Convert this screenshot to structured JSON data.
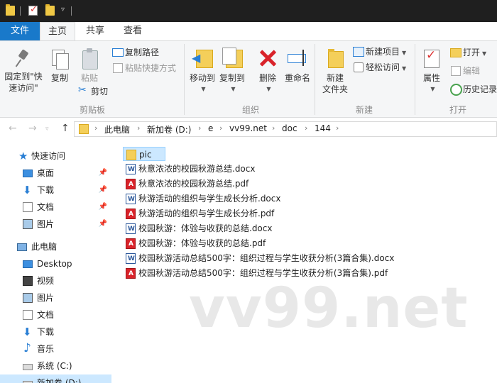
{
  "titlebar": {
    "icons": [
      "folder-icon",
      "properties-icon",
      "new-folder-icon"
    ]
  },
  "tabs": {
    "file": "文件",
    "home": "主页",
    "share": "共享",
    "view": "查看"
  },
  "ribbon": {
    "clipboard": {
      "label": "剪贴板",
      "pin_quick_access": "固定到\"快速访问\"",
      "copy": "复制",
      "paste": "粘贴",
      "copy_path": "复制路径",
      "paste_shortcut": "粘贴快捷方式",
      "cut": "剪切"
    },
    "organize": {
      "label": "组织",
      "move_to": "移动到",
      "copy_to": "复制到",
      "delete": "删除",
      "rename": "重命名"
    },
    "new": {
      "label": "新建",
      "new_folder": "新建\n文件夹",
      "new_item": "新建项目",
      "easy_access": "轻松访问"
    },
    "open": {
      "label": "打开",
      "properties": "属性",
      "open": "打开",
      "edit": "编辑",
      "history": "历史记录"
    }
  },
  "address": {
    "crumbs": [
      "此电脑",
      "新加卷 (D:)",
      "e",
      "vv99.net",
      "doc",
      "144"
    ]
  },
  "navpane": {
    "quick_access": "快速访问",
    "quick_items": [
      "桌面",
      "下载",
      "文档",
      "图片"
    ],
    "this_pc": "此电脑",
    "pc_items": [
      "Desktop",
      "视频",
      "图片",
      "文档",
      "下载",
      "音乐",
      "系统 (C:)",
      "新加卷 (D:)"
    ]
  },
  "files": [
    {
      "name": "pic",
      "type": "folder"
    },
    {
      "name": "秋意浓浓的校园秋游总结.docx",
      "type": "docx"
    },
    {
      "name": "秋意浓浓的校园秋游总结.pdf",
      "type": "pdf"
    },
    {
      "name": "秋游活动的组织与学生成长分析.docx",
      "type": "docx"
    },
    {
      "name": "秋游活动的组织与学生成长分析.pdf",
      "type": "pdf"
    },
    {
      "name": "校园秋游：体验与收获的总结.docx",
      "type": "docx"
    },
    {
      "name": "校园秋游：体验与收获的总结.pdf",
      "type": "pdf"
    },
    {
      "name": "校园秋游活动总结500字：组织过程与学生收获分析(3篇合集).docx",
      "type": "docx"
    },
    {
      "name": "校园秋游活动总结500字：组织过程与学生收获分析(3篇合集).pdf",
      "type": "pdf"
    }
  ],
  "watermark": "vv99.net"
}
